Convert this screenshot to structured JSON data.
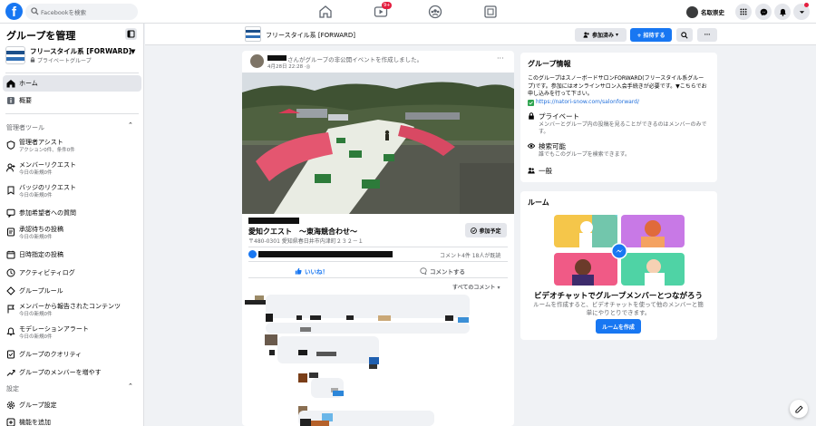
{
  "topbar": {
    "logo": "f",
    "search_placeholder": "Facebookを検索",
    "watch_badge": "9+",
    "user_name": "名取崇史"
  },
  "sidebar": {
    "title": "グループを管理",
    "group_name": "フリースタイル系 [FORWARD]",
    "group_type": "プライベートグループ",
    "nav": [
      {
        "label": "ホーム",
        "icon": "home-icon",
        "active": true
      },
      {
        "label": "概要",
        "icon": "info-icon"
      }
    ],
    "admin_section": "管理者ツール",
    "admin_items": [
      {
        "label": "管理者アシスト",
        "sub": "アクション0件、条件0件",
        "icon": "assist-icon"
      },
      {
        "label": "メンバーリクエスト",
        "sub": "今日の新規0件",
        "icon": "member-request-icon"
      },
      {
        "label": "バッジのリクエスト",
        "sub": "今日の新規0件",
        "icon": "badge-icon"
      },
      {
        "label": "参加希望者への質問",
        "icon": "question-icon"
      },
      {
        "label": "承認待ちの投稿",
        "sub": "今日の新規0件",
        "icon": "pending-icon"
      },
      {
        "label": "日時指定の投稿",
        "icon": "calendar-icon"
      },
      {
        "label": "アクティビティログ",
        "icon": "activity-icon"
      },
      {
        "label": "グループルール",
        "icon": "rules-icon"
      },
      {
        "label": "メンバーから報告されたコンテンツ",
        "sub": "今日の新規0件",
        "icon": "report-icon"
      },
      {
        "label": "モデレーションアラート",
        "sub": "今日の新規0件",
        "icon": "alert-icon"
      },
      {
        "label": "グループのクオリティ",
        "icon": "quality-icon"
      },
      {
        "label": "グループのメンバーを増やす",
        "icon": "grow-icon"
      }
    ],
    "settings_section": "設定",
    "settings_items": [
      {
        "label": "グループ設定",
        "icon": "settings-icon"
      },
      {
        "label": "機能を追加",
        "icon": "add-feature-icon"
      }
    ]
  },
  "group_header": {
    "name": "フリースタイル系 [FORWARD]",
    "joined_label": "参加済み",
    "invite_label": "+ 招待する",
    "more_label": "···"
  },
  "post": {
    "action_text": "さんがグループの非公開イベントを作成しました。",
    "date": "4月28日 22:28",
    "event_title": "愛知クエスト　～東海競合わせ～",
    "event_address": "〒480-0301 愛知県春日井市内津町２３２－１",
    "going_label": "参加予定",
    "stats": "コメント4件  18人が既読",
    "like_label": "いいね！",
    "comment_label": "コメントする",
    "all_comments_label": "すべてのコメント"
  },
  "about": {
    "title": "グループ情報",
    "description": "このグループはスノーボードサロンFORWARD(フリースタイル系グループ)です。参加にはオンラインサロン入会手続きが必要です。▼こちらでお申し込みを行って下さい。",
    "link": "https://natori-snow.com/salonforward/",
    "privacy_title": "プライベート",
    "privacy_desc": "メンバーとグループ内の投稿を見ることができるのはメンバーのみです。",
    "visible_title": "検索可能",
    "visible_desc": "誰でもこのグループを検索できます。",
    "general": "一般"
  },
  "rooms": {
    "title": "ルーム",
    "headline": "ビデオチャットでグループメンバーとつながろう",
    "desc": "ルームを作成すると、ビデオチャットを使って他のメンバーと簡単にやりとりできます。",
    "button": "ルームを作成"
  },
  "colors": {
    "brand": "#1877f2",
    "badge": "#e41e3f"
  }
}
